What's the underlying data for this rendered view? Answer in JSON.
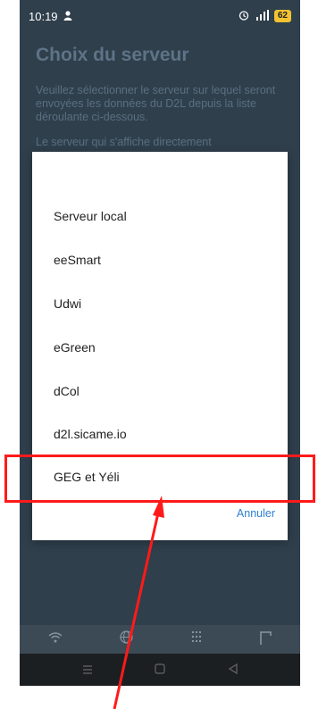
{
  "status": {
    "time": "10:19",
    "battery": "62"
  },
  "page": {
    "title": "Choix du serveur",
    "description": "Veuillez sélectionner le serveur sur lequel seront envoyées les données du D2L depuis la liste déroulante ci-dessous.",
    "description2": "Le serveur qui s'affiche directement"
  },
  "dialog": {
    "options": [
      "Serveur local",
      "eeSmart",
      "Udwi",
      "eGreen",
      "dCol",
      "d2l.sicame.io",
      "GEG et Yéli"
    ],
    "cancel_label": "Annuler"
  },
  "bottom_nav": {
    "icons": [
      "wifi-icon",
      "globe-icon",
      "binary-icon",
      "corner-icon"
    ]
  },
  "system_nav": {
    "icons": [
      "menu-icon",
      "home-icon",
      "back-icon"
    ]
  },
  "annotation": {
    "highlight_color": "#ff1a1a"
  }
}
